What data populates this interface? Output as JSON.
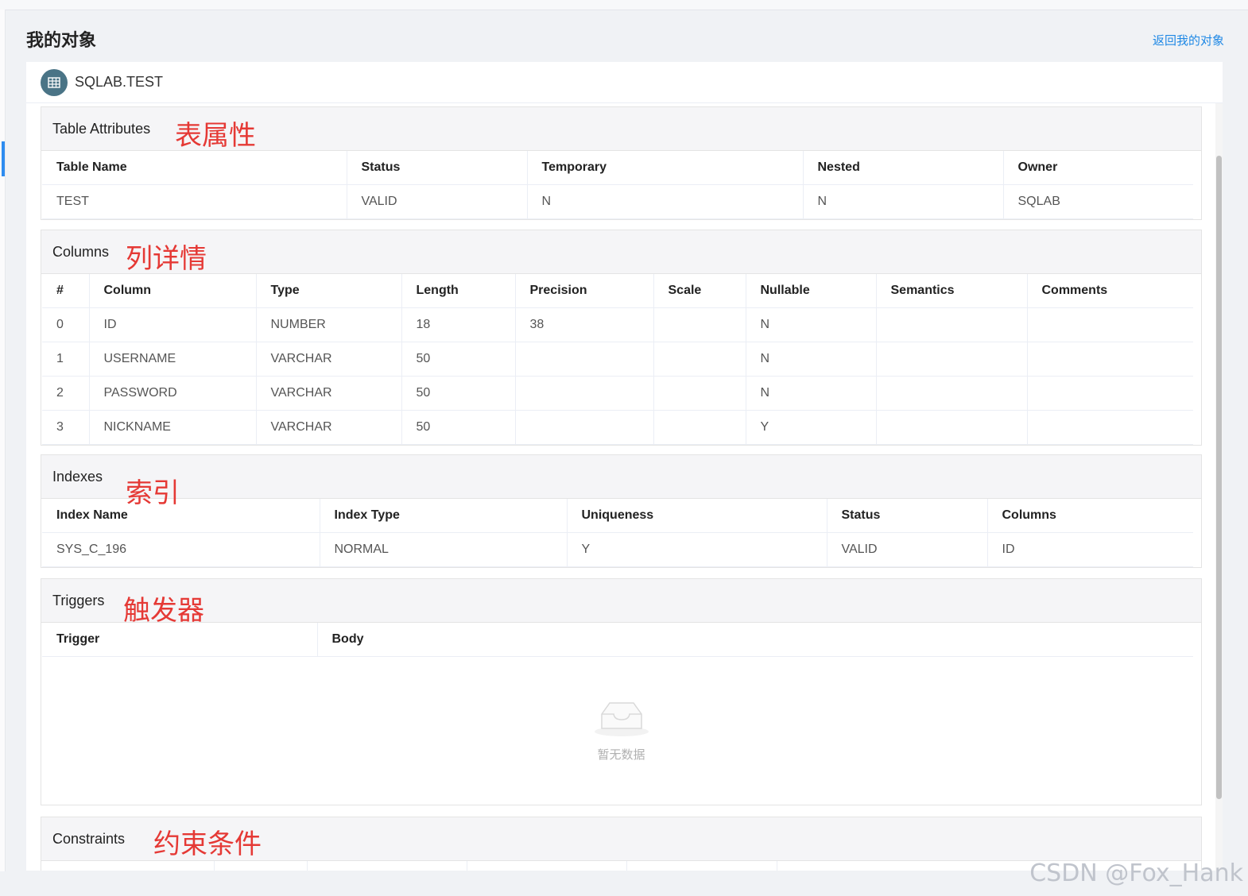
{
  "page": {
    "title": "我的对象",
    "back_link": "返回我的对象"
  },
  "object": {
    "name": "SQLAB.TEST",
    "icon": "table-icon"
  },
  "table_attributes": {
    "title": "Table Attributes",
    "annotation": "表属性",
    "headers": [
      "Table Name",
      "Status",
      "Temporary",
      "Nested",
      "Owner"
    ],
    "rows": [
      [
        "TEST",
        "VALID",
        "N",
        "N",
        "SQLAB"
      ]
    ]
  },
  "columns": {
    "title": "Columns",
    "annotation": "列详情",
    "headers": [
      "#",
      "Column",
      "Type",
      "Length",
      "Precision",
      "Scale",
      "Nullable",
      "Semantics",
      "Comments"
    ],
    "rows": [
      [
        "0",
        "ID",
        "NUMBER",
        "18",
        "38",
        "",
        "N",
        "",
        ""
      ],
      [
        "1",
        "USERNAME",
        "VARCHAR",
        "50",
        "",
        "",
        "N",
        "",
        ""
      ],
      [
        "2",
        "PASSWORD",
        "VARCHAR",
        "50",
        "",
        "",
        "N",
        "",
        ""
      ],
      [
        "3",
        "NICKNAME",
        "VARCHAR",
        "50",
        "",
        "",
        "Y",
        "",
        ""
      ]
    ]
  },
  "indexes": {
    "title": "Indexes",
    "annotation": "索引",
    "headers": [
      "Index Name",
      "Index Type",
      "Uniqueness",
      "Status",
      "Columns"
    ],
    "rows": [
      [
        "SYS_C_196",
        "NORMAL",
        "Y",
        "VALID",
        "ID"
      ]
    ]
  },
  "triggers": {
    "title": "Triggers",
    "annotation": "触发器",
    "headers": [
      "Trigger",
      "Body"
    ],
    "empty_text": "暂无数据"
  },
  "constraints": {
    "title": "Constraints",
    "annotation": "约束条件"
  },
  "watermark": "CSDN @Fox_Hank",
  "colors": {
    "accent": "#2d8cf0",
    "link": "#1e88e5",
    "annotation": "#e53935",
    "icon_bg": "#4a7486"
  }
}
